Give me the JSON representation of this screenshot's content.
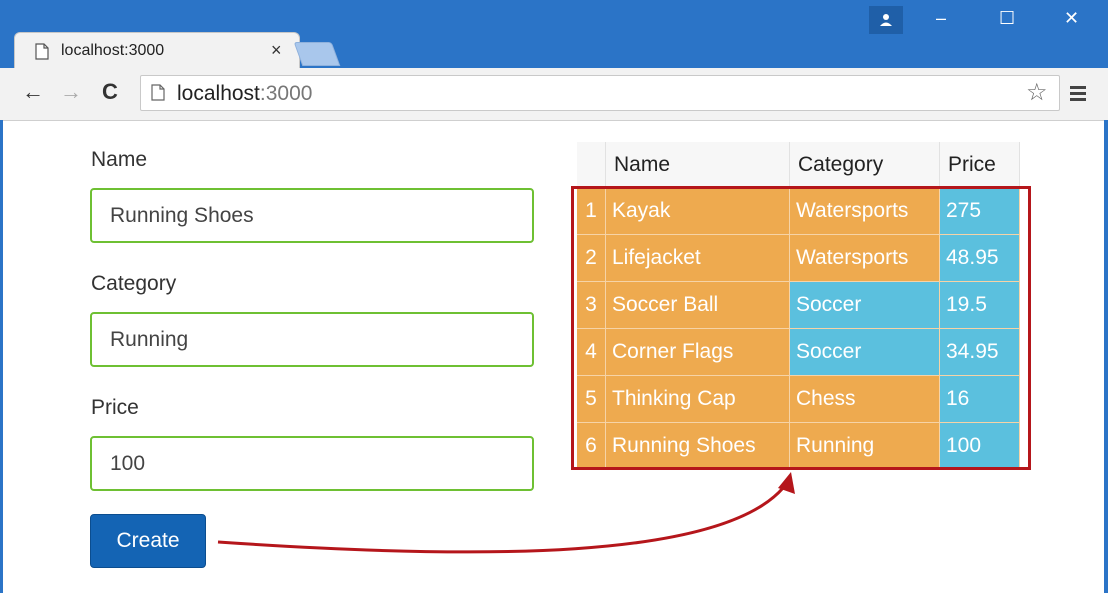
{
  "browser": {
    "tab_title": "localhost:3000",
    "tab_close": "×",
    "url_host": "localhost",
    "url_port": ":3000",
    "minimize": "–",
    "maximize": "☐",
    "close": "✕",
    "back": "←",
    "forward": "→",
    "reload": "C",
    "star": "☆"
  },
  "form": {
    "name_label": "Name",
    "name_value": "Running Shoes",
    "category_label": "Category",
    "category_value": "Running",
    "price_label": "Price",
    "price_value": "100",
    "create_label": "Create"
  },
  "table": {
    "headers": [
      "",
      "Name",
      "Category",
      "Price"
    ],
    "rows": [
      [
        "1",
        "Kayak",
        "Watersports",
        "275"
      ],
      [
        "2",
        "Lifejacket",
        "Watersports",
        "48.95"
      ],
      [
        "3",
        "Soccer Ball",
        "Soccer",
        "19.5"
      ],
      [
        "4",
        "Corner Flags",
        "Soccer",
        "34.95"
      ],
      [
        "5",
        "Thinking Cap",
        "Chess",
        "16"
      ],
      [
        "6",
        "Running Shoes",
        "Running",
        "100"
      ]
    ],
    "row_colors": [
      [
        "orange",
        "orange",
        "orange",
        "blue"
      ],
      [
        "orange",
        "orange",
        "orange",
        "blue"
      ],
      [
        "orange",
        "orange",
        "blue",
        "blue"
      ],
      [
        "orange",
        "orange",
        "blue",
        "blue"
      ],
      [
        "orange",
        "orange",
        "orange",
        "blue"
      ],
      [
        "orange",
        "orange",
        "orange",
        "blue"
      ]
    ]
  },
  "colors": {
    "orange": "#eeaa4f",
    "blue": "#5bc0de",
    "highlight": "#b5161b",
    "field_border": "#6ec033",
    "button": "#1464b4",
    "titlebar": "#2b74c7"
  }
}
